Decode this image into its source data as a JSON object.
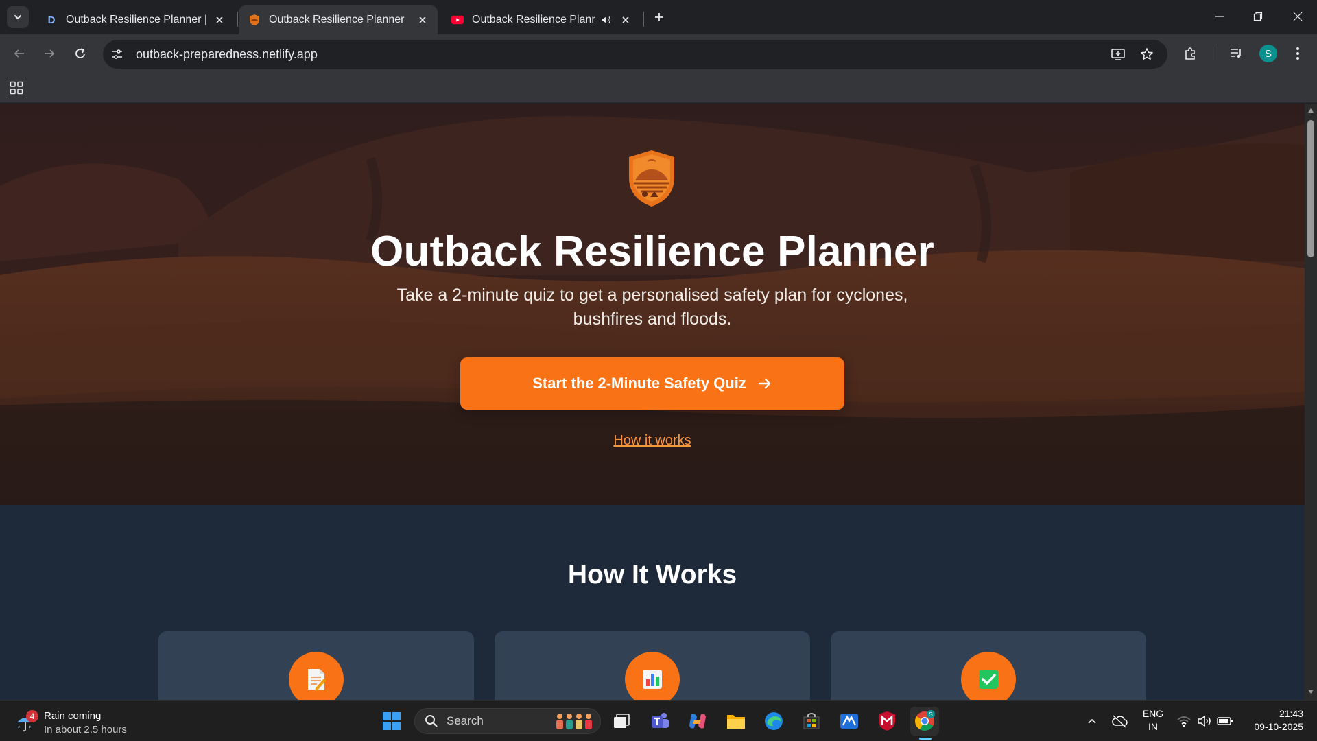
{
  "browser": {
    "tabs": [
      {
        "title": "Outback Resilience Planner | De",
        "favicon": "d-letter-icon",
        "active": false
      },
      {
        "title": "Outback Resilience Planner",
        "favicon": "uluru-shield-icon",
        "active": true
      },
      {
        "title": "Outback Resilience Planner",
        "favicon": "youtube-icon",
        "active": false,
        "audio": true
      }
    ],
    "tab_letter": "D",
    "address": "outback-preparedness.netlify.app",
    "profile_initial": "S"
  },
  "page": {
    "hero": {
      "title": "Outback Resilience Planner",
      "subtitle": "Take a 2-minute quiz to get a personalised safety plan for cyclones, bushfires and floods.",
      "cta_label": "Start the 2-Minute Safety Quiz",
      "link_label": "How it works"
    },
    "how_it_works": {
      "title": "How It Works",
      "cards": [
        {
          "icon": "memo-icon"
        },
        {
          "icon": "bar-chart-icon"
        },
        {
          "icon": "check-mark-icon"
        }
      ]
    },
    "colors": {
      "accent": "#f97316",
      "section_bg": "#1e2939",
      "card_bg": "#334155",
      "link": "#fb923c"
    }
  },
  "taskbar": {
    "weather": {
      "line1": "Rain coming",
      "line2": "In about 2.5 hours",
      "badge": "4"
    },
    "search_placeholder": "Search",
    "language": {
      "line1": "ENG",
      "line2": "IN"
    },
    "clock": {
      "time": "21:43",
      "date": "09-10-2025"
    },
    "chrome_badge": "S"
  }
}
